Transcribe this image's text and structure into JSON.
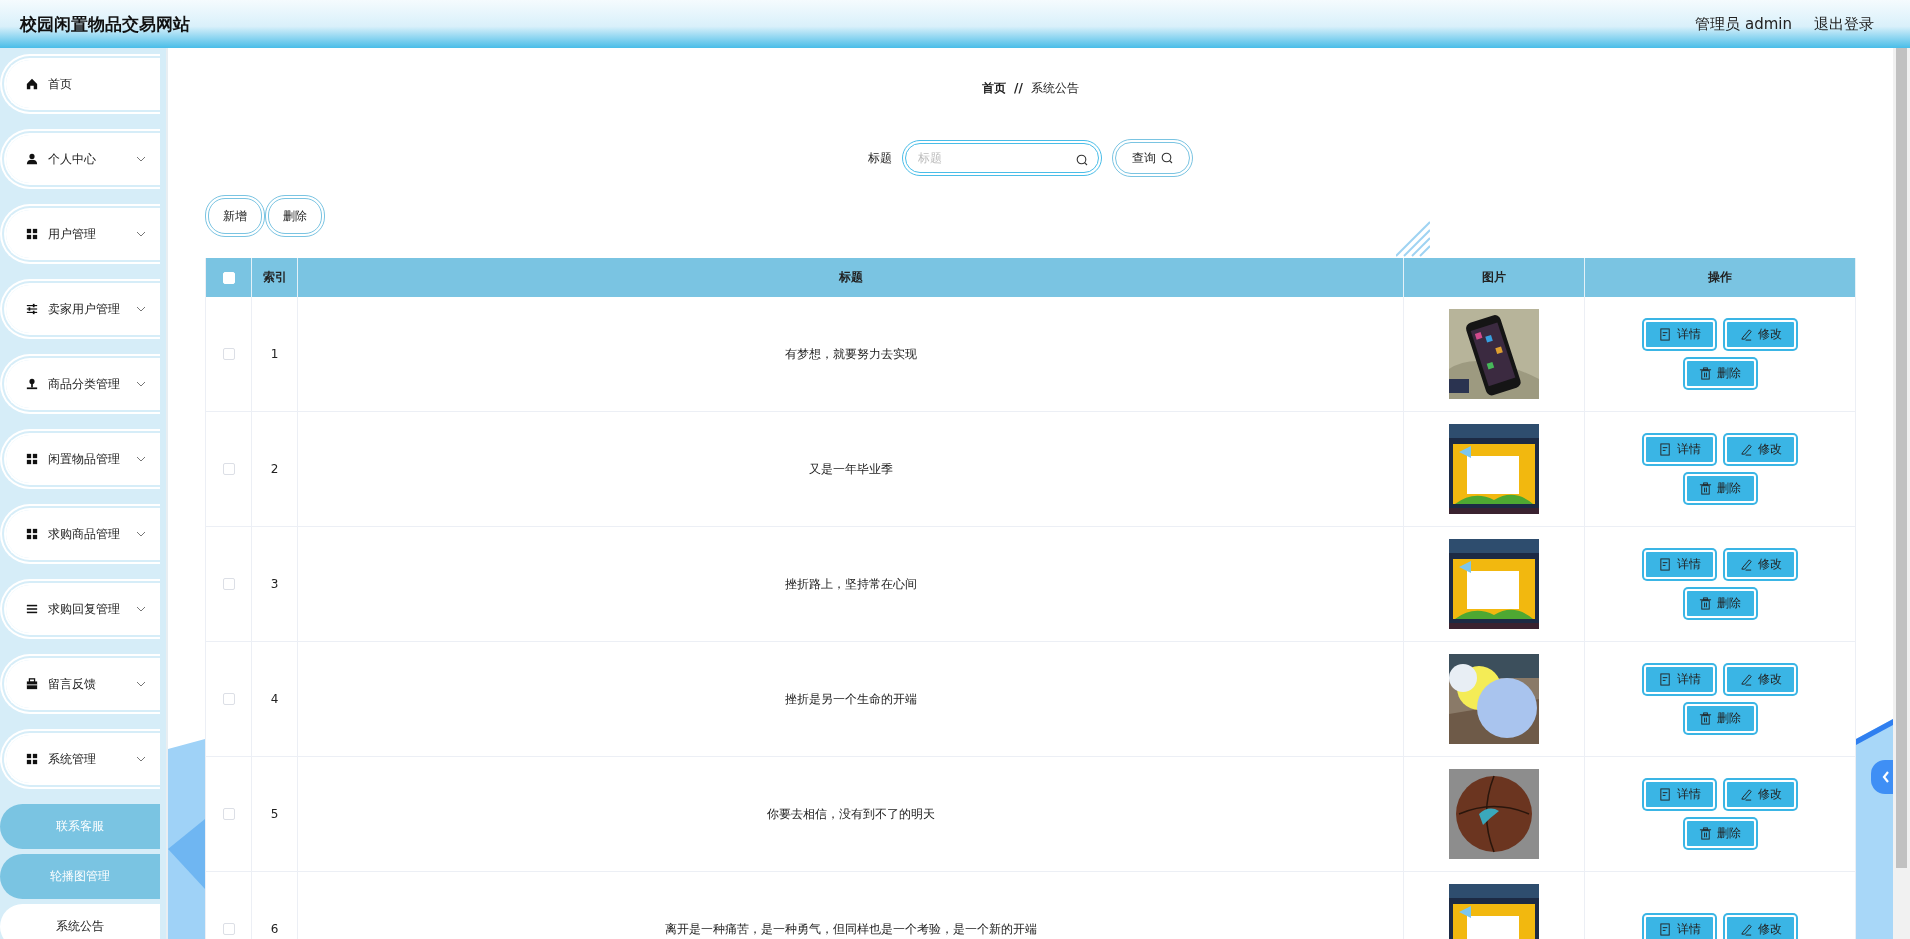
{
  "header": {
    "title": "校园闲置物品交易网站",
    "user": "管理员 admin",
    "logout": "退出登录"
  },
  "sidebar": {
    "items": [
      {
        "kind": "link",
        "label": "首页"
      },
      {
        "kind": "menu",
        "label": "个人中心"
      },
      {
        "kind": "menu",
        "label": "用户管理"
      },
      {
        "kind": "menu",
        "label": "卖家用户管理"
      },
      {
        "kind": "menu",
        "label": "商品分类管理"
      },
      {
        "kind": "menu",
        "label": "闲置物品管理"
      },
      {
        "kind": "menu",
        "label": "求购商品管理"
      },
      {
        "kind": "menu",
        "label": "求购回复管理"
      },
      {
        "kind": "menu",
        "label": "留言反馈"
      },
      {
        "kind": "menu",
        "label": "系统管理",
        "expanded": true,
        "children": [
          {
            "label": "联系客服",
            "selected": false
          },
          {
            "label": "轮播图管理",
            "selected": false
          },
          {
            "label": "系统公告",
            "selected": true
          }
        ]
      }
    ]
  },
  "breadcrumb": {
    "home": "首页",
    "separator": "//",
    "current": "系统公告"
  },
  "search": {
    "label": "标题",
    "placeholder": "标题",
    "button": "查询"
  },
  "toolbar": [
    "新增",
    "删除"
  ],
  "table": {
    "select_all": false,
    "columns": [
      "索引",
      "标题",
      "图片",
      "操作"
    ],
    "rows": [
      {
        "selected": false,
        "index": "1",
        "title": "有梦想，就要努力去实现",
        "image": {
          "kind": "picture"
        },
        "actions": [
          {
            "kind": "detail",
            "label": "详情"
          },
          {
            "kind": "edit",
            "label": "修改"
          },
          {
            "kind": "delete",
            "label": "删除"
          }
        ]
      },
      {
        "selected": false,
        "index": "2",
        "title": "又是一年毕业季",
        "image": {
          "kind": "picture"
        },
        "actions": [
          {
            "kind": "detail",
            "label": "详情"
          },
          {
            "kind": "edit",
            "label": "修改"
          },
          {
            "kind": "delete",
            "label": "删除"
          }
        ]
      },
      {
        "selected": false,
        "index": "3",
        "title": "挫折路上，坚持常在心间",
        "image": {
          "kind": "picture"
        },
        "actions": [
          {
            "kind": "detail",
            "label": "详情"
          },
          {
            "kind": "edit",
            "label": "修改"
          },
          {
            "kind": "delete",
            "label": "删除"
          }
        ]
      },
      {
        "selected": false,
        "index": "4",
        "title": "挫折是另一个生命的开端",
        "image": {
          "kind": "picture"
        },
        "actions": [
          {
            "kind": "detail",
            "label": "详情"
          },
          {
            "kind": "edit",
            "label": "修改"
          },
          {
            "kind": "delete",
            "label": "删除"
          }
        ]
      },
      {
        "selected": false,
        "index": "5",
        "title": "你要去相信，没有到不了的明天",
        "image": {
          "kind": "picture"
        },
        "actions": [
          {
            "kind": "detail",
            "label": "详情"
          },
          {
            "kind": "edit",
            "label": "修改"
          },
          {
            "kind": "delete",
            "label": "删除"
          }
        ]
      },
      {
        "selected": false,
        "index": "6",
        "title": "离开是一种痛苦，是一种勇气，但同样也是一个考验，是一个新的开端",
        "image": {
          "kind": "picture"
        },
        "actions": [
          {
            "kind": "detail",
            "label": "详情"
          },
          {
            "kind": "edit",
            "label": "修改"
          }
        ]
      }
    ]
  }
}
